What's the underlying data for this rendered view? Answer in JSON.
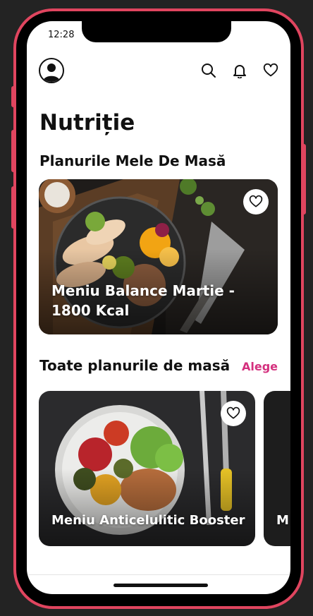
{
  "status_bar": {
    "time": "12:28"
  },
  "header": {
    "icons": [
      "avatar-icon",
      "search-icon",
      "bell-icon",
      "heart-icon"
    ]
  },
  "page": {
    "title": "Nutriție"
  },
  "my_plans": {
    "title": "Planurile Mele De Masă",
    "cards": [
      {
        "title": "Meniu Balance Martie - 1800 Kcal",
        "favorite": false
      }
    ]
  },
  "all_plans": {
    "title": "Toate planurile de masă",
    "action_label": "Alege",
    "cards": [
      {
        "title": "Meniu Anticelulitic Booster",
        "favorite": false
      },
      {
        "title": "M"
      }
    ]
  },
  "colors": {
    "frame": "#e0455f",
    "accent": "#d4307e",
    "background": "#ffffff",
    "text": "#111111"
  }
}
